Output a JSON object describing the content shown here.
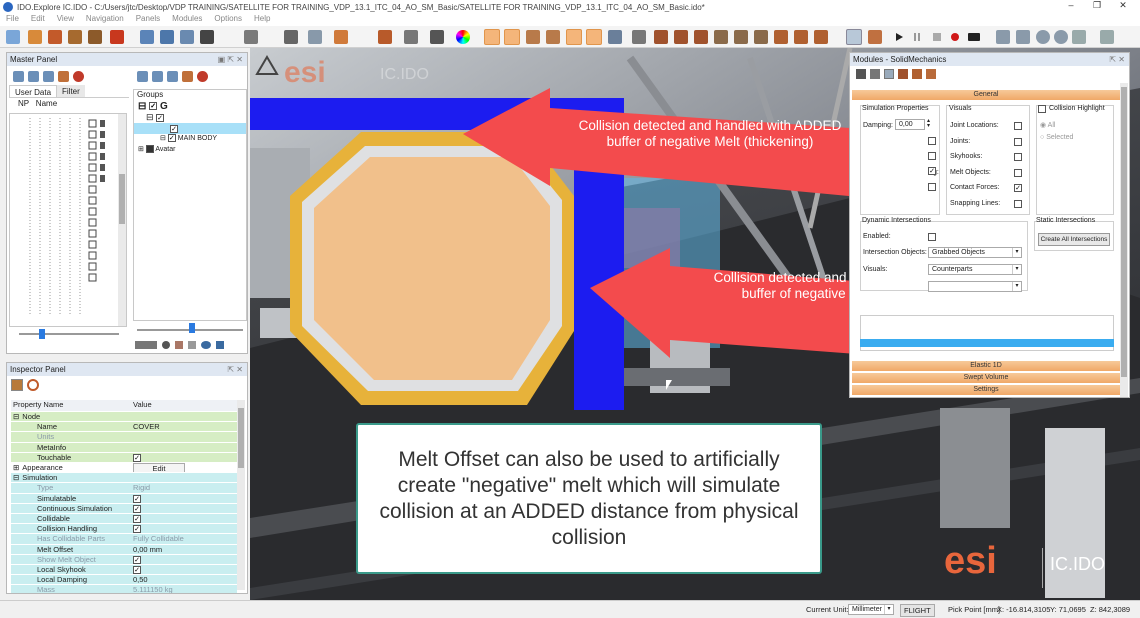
{
  "window": {
    "title": "IDO.Explore IC.IDO - C:/Users/jtc/Desktop/VDP TRAINING/SATELLITE FOR TRAINING_VDP_13.1_ITC_04_AO_SM_Basic/SATELLITE FOR TRAINING_VDP_13.1_ITC_04_AO_SM_Basic.ido*",
    "min": "–",
    "max": "❐",
    "close": "✕"
  },
  "menu": [
    "File",
    "Edit",
    "View",
    "Navigation",
    "Panels",
    "Modules",
    "Options",
    "Help"
  ],
  "master_panel": {
    "title": "Master Panel",
    "tabs": [
      "User Data",
      "Filter"
    ],
    "columns": [
      "NP",
      "Name"
    ],
    "groups_label": "Groups",
    "tree": [
      {
        "label": "G",
        "checked": true
      },
      {
        "label": "",
        "checked": true
      },
      {
        "label": "",
        "checked": true
      },
      {
        "label": "MAIN BODY",
        "checked": true
      },
      {
        "label": "Avatar",
        "checked": true
      }
    ]
  },
  "inspector": {
    "title": "Inspector Panel",
    "header": {
      "name": "Property Name",
      "value": "Value"
    },
    "rows": [
      {
        "name": "Node",
        "value": "",
        "level": 0,
        "toggle": "⊟",
        "bg": "node",
        "check": null,
        "grey": false
      },
      {
        "name": "Name",
        "value": "COVER",
        "level": 1,
        "toggle": "",
        "bg": "node",
        "check": null,
        "grey": false
      },
      {
        "name": "Units",
        "value": "",
        "level": 1,
        "toggle": "",
        "bg": "node",
        "check": null,
        "grey": true
      },
      {
        "name": "MetaInfo",
        "value": "",
        "level": 1,
        "toggle": "",
        "bg": "node",
        "check": null,
        "grey": false
      },
      {
        "name": "Touchable",
        "value": "",
        "level": 1,
        "toggle": "",
        "bg": "node",
        "check": true,
        "grey": false
      },
      {
        "name": "Appearance",
        "value": "Edit",
        "level": 0,
        "toggle": "⊞",
        "bg": "plain",
        "check": null,
        "grey": false
      },
      {
        "name": "Simulation",
        "value": "",
        "level": 0,
        "toggle": "⊟",
        "bg": "sim",
        "check": null,
        "grey": false
      },
      {
        "name": "Type",
        "value": "Rigid",
        "level": 1,
        "toggle": "",
        "bg": "sim",
        "check": null,
        "grey": true
      },
      {
        "name": "Simulatable",
        "value": "",
        "level": 1,
        "toggle": "",
        "bg": "sim",
        "check": true,
        "grey": false
      },
      {
        "name": "Continuous Simulation",
        "value": "",
        "level": 1,
        "toggle": "",
        "bg": "sim",
        "check": true,
        "grey": false
      },
      {
        "name": "Collidable",
        "value": "",
        "level": 1,
        "toggle": "",
        "bg": "sim",
        "check": true,
        "grey": false
      },
      {
        "name": "Collision Handling",
        "value": "",
        "level": 1,
        "toggle": "",
        "bg": "sim",
        "check": true,
        "grey": false
      },
      {
        "name": "Has Collidable Parts",
        "value": "Fully Collidable",
        "level": 1,
        "toggle": "",
        "bg": "sim",
        "check": null,
        "grey": true
      },
      {
        "name": "Melt Offset",
        "value": "0,00 mm",
        "level": 1,
        "toggle": "",
        "bg": "sim",
        "check": null,
        "grey": false
      },
      {
        "name": "Show Melt Object",
        "value": "",
        "level": 1,
        "toggle": "",
        "bg": "sim",
        "check": true,
        "grey": true
      },
      {
        "name": "Local Skyhook",
        "value": "",
        "level": 1,
        "toggle": "",
        "bg": "sim",
        "check": true,
        "grey": false
      },
      {
        "name": "Local Damping",
        "value": "0,50",
        "level": 1,
        "toggle": "",
        "bg": "sim",
        "check": null,
        "grey": false
      },
      {
        "name": "Mass",
        "value": "5.111150 kg",
        "level": 1,
        "toggle": "",
        "bg": "sim",
        "check": null,
        "grey": true
      }
    ]
  },
  "modules": {
    "title": "Modules - SolidMechanics",
    "general": "General",
    "sim_props": "Simulation Properties",
    "damping_label": "Damping:",
    "damping_value": "0,00",
    "visuals_label": "Visuals",
    "visual_items": [
      {
        "label": "Joint Locations:",
        "checked": false
      },
      {
        "label": "Joints:",
        "checked": false
      },
      {
        "label": "Skyhooks:",
        "checked": false
      },
      {
        "label": "Melt Objects:",
        "checked": false
      },
      {
        "label": "Contact Forces:",
        "checked": true
      },
      {
        "label": "Snapping Lines:",
        "checked": false
      }
    ],
    "left_partial": "g:",
    "collision_highlight": "Collision Highlight",
    "radio_all": "All",
    "radio_selected": "Selected",
    "dyn_title": "Dynamic Intersections",
    "enabled": "Enabled:",
    "intersection_objects": "Intersection Objects:",
    "intersection_value": "Grabbed Objects",
    "visuals2": "Visuals:",
    "visuals2_value": "Counterparts",
    "static_title": "Static Intersections",
    "create_all": "Create All Intersections",
    "elastic": "Elastic 1D",
    "swept": "Swept Volume",
    "settings": "Settings"
  },
  "callouts": {
    "top": "Collision detected and handled with ADDED buffer of negative Melt (thickening)",
    "bottom": "Collision detected and handled with ADDED buffer of negative Melt (thickening)",
    "info": "Melt Offset can also be used to artificially create \"negative\" melt which will simulate collision at an ADDED distance from physical collision"
  },
  "logo": {
    "brand": "esi",
    "product": "IC.IDO"
  },
  "statusbar": {
    "current_unit_label": "Current Unit:",
    "unit_value": "Millimeter",
    "mode": "FLIGHT",
    "pick_point": "Pick Point [mm]",
    "x": "X: -16.814,3105",
    "y": "Y: 71,0695",
    "z": "Z: 842,3089"
  },
  "colors": {
    "accent": "#f0a868",
    "arrow": "#f34b4d",
    "blue": "#1c1cf0",
    "octagon": "#f1c08b",
    "gold": "#e7b23a",
    "esi": "#e8663c"
  }
}
